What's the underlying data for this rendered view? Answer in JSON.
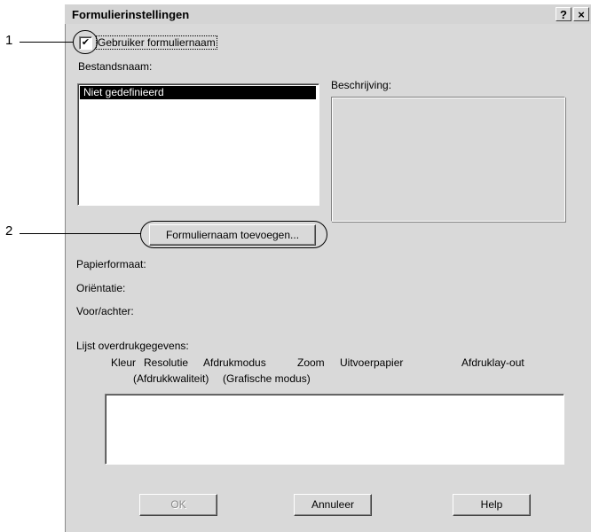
{
  "window": {
    "title": "Formulierinstellingen",
    "help_button": "?",
    "close_button": "×"
  },
  "callouts": {
    "one": "1",
    "two": "2"
  },
  "use_form_name": {
    "label": "Gebruiker formuliernaam",
    "checked": true
  },
  "file_name": {
    "label": "Bestandsnaam:",
    "items": [
      "Niet gedefinieerd"
    ],
    "selected_index": 0
  },
  "description": {
    "label": "Beschrijving:"
  },
  "add_form_button": "Formuliernaam toevoegen...",
  "info": {
    "paper_size": "Papierformaat:",
    "orientation": "Oriëntatie:",
    "front_back": "Voor/achter:"
  },
  "overlay_list": {
    "label": "Lijst overdrukgegevens:",
    "columns": {
      "color": "Kleur",
      "resolution": "Resolutie",
      "print_quality": "(Afdrukkwaliteit)",
      "print_mode": "Afdrukmodus",
      "graphic_mode": "(Grafische modus)",
      "zoom": "Zoom",
      "output_paper": "Uitvoerpapier",
      "print_layout": "Afdruklay-out"
    }
  },
  "buttons": {
    "ok": "OK",
    "cancel": "Annuleer",
    "help": "Help"
  }
}
